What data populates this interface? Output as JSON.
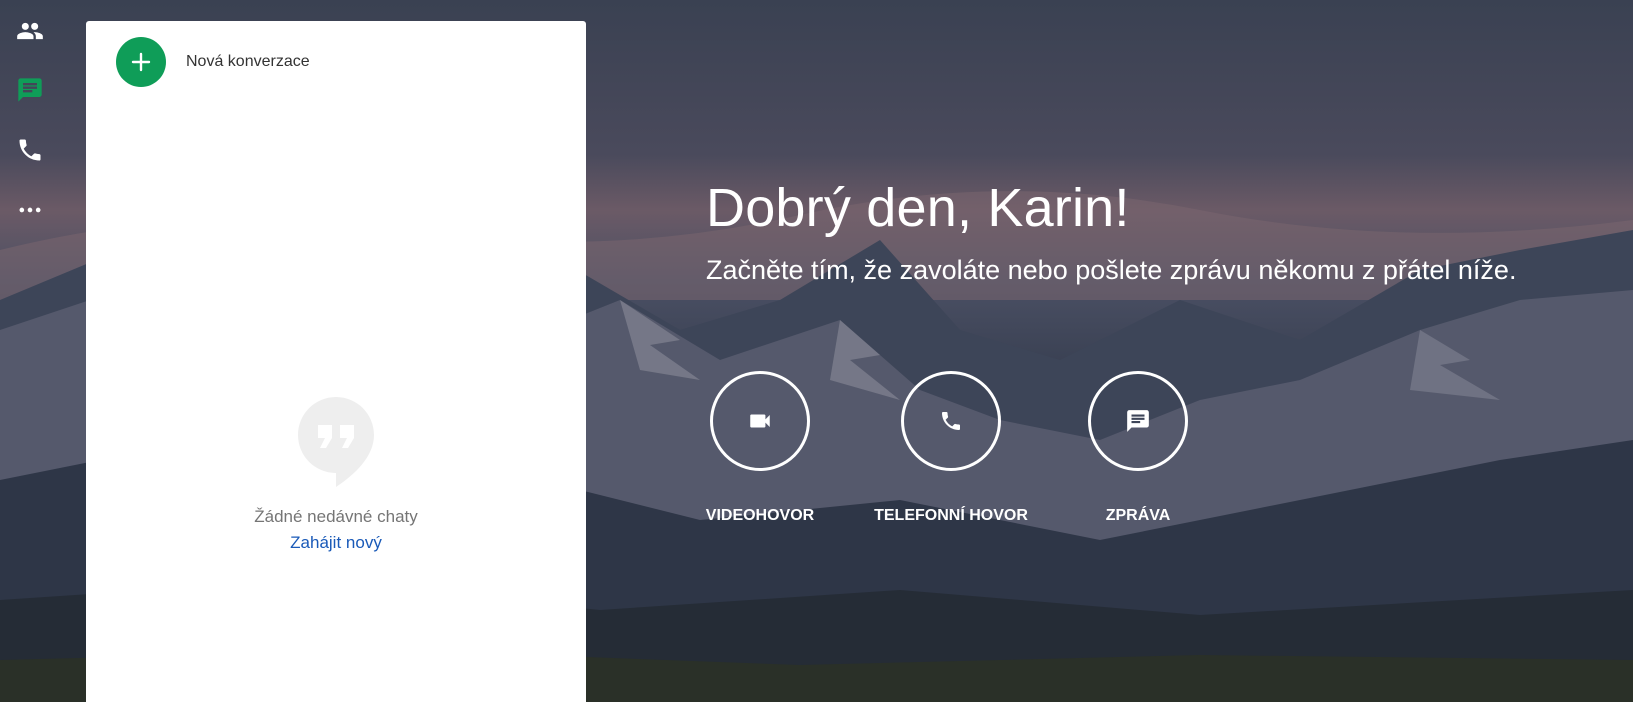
{
  "rail": {
    "items": [
      {
        "name": "contacts",
        "icon": "people-icon",
        "color": "#ffffff"
      },
      {
        "name": "chats",
        "icon": "chat-icon",
        "color": "#0f9d58"
      },
      {
        "name": "calls",
        "icon": "phone-icon",
        "color": "#ffffff"
      },
      {
        "name": "more",
        "icon": "more-horiz-icon",
        "color": "#ffffff"
      }
    ]
  },
  "panel": {
    "new_conversation_label": "Nová konverzace",
    "empty_text": "Žádné nedávné chaty",
    "start_new_link": "Zahájit nový"
  },
  "main": {
    "greeting": "Dobrý den, Karin!",
    "subgreeting": "Začněte tím, že zavoláte nebo pošlete zprávu někomu z přátel níže.",
    "actions": [
      {
        "label": "VIDEOHOVOR",
        "icon": "videocam-icon"
      },
      {
        "label": "TELEFONNÍ HOVOR",
        "icon": "phone-icon"
      },
      {
        "label": "ZPRÁVA",
        "icon": "message-icon"
      }
    ]
  },
  "colors": {
    "accent": "#0f9d58",
    "link": "#1a5ab8"
  }
}
